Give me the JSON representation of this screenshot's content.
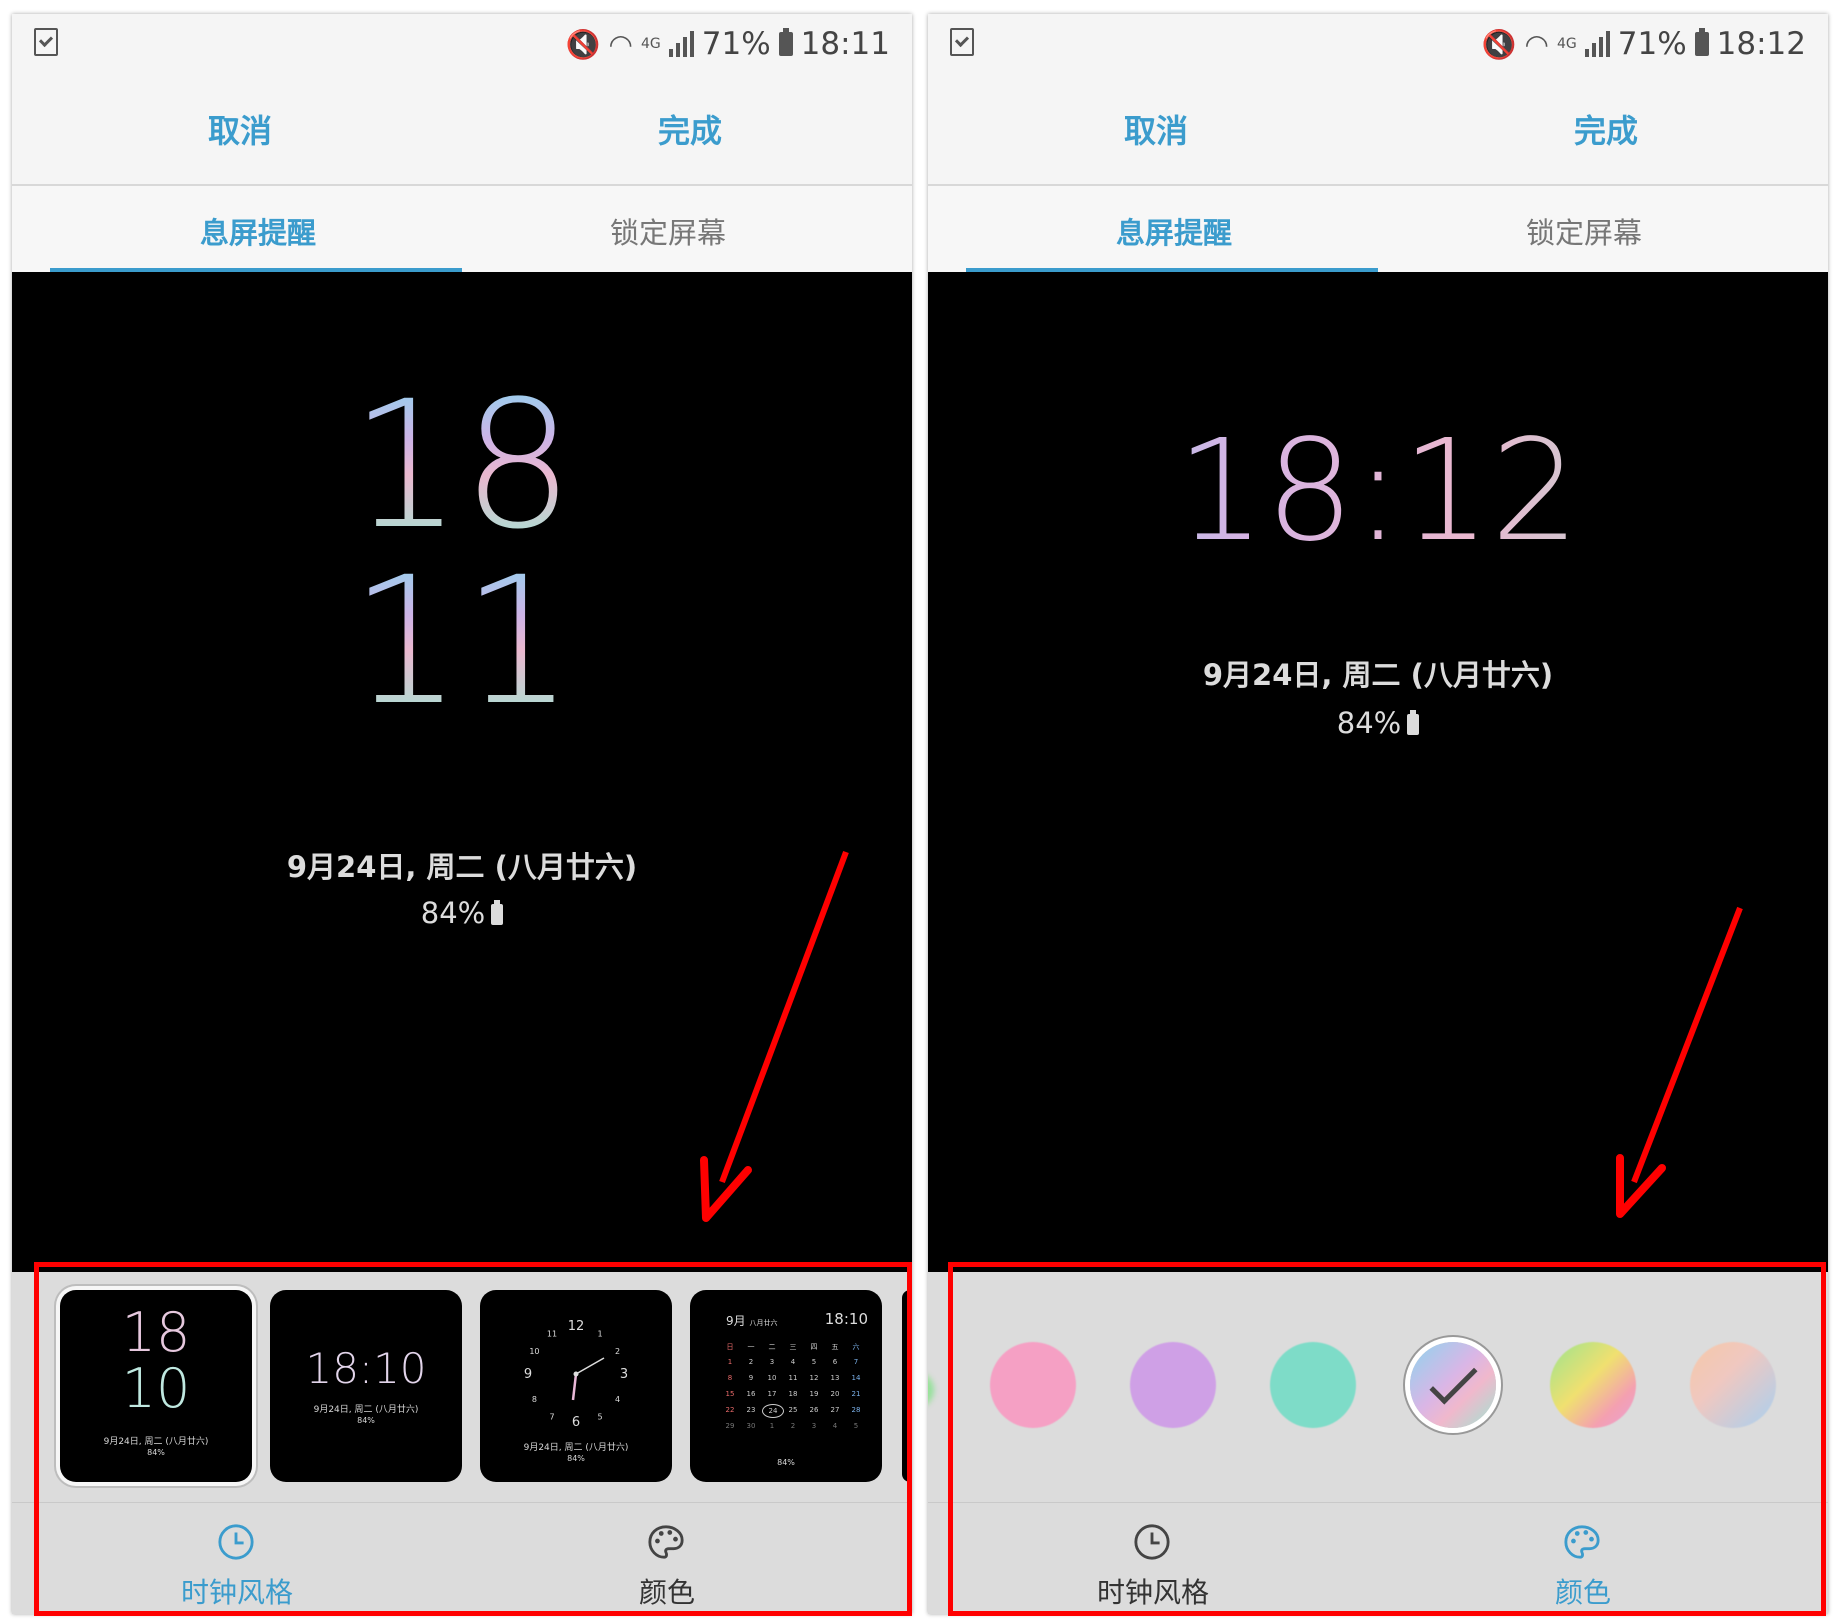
{
  "phones": [
    {
      "status": {
        "signal_tag": "4G",
        "battery": "71%",
        "time": "18:11"
      },
      "action": {
        "cancel": "取消",
        "done": "完成"
      },
      "tabs": {
        "aod": "息屏提醒",
        "lock": "锁定屏幕"
      },
      "clock": {
        "hour": "18",
        "minute": "11"
      },
      "date": "9月24日, 周二 (八月廿六)",
      "battery": "84%",
      "bottom_tabs": {
        "clock_style": "时钟风格",
        "color": "颜色"
      },
      "active_bottom_tab": "clock_style",
      "thumbnails": [
        {
          "hour": "18",
          "minute": "10",
          "date": "9月24日, 周二 (八月廿六)",
          "battery": "84%"
        },
        {
          "time": "18:10",
          "date": "9月24日, 周二 (八月廿六)",
          "battery": "84%"
        },
        {
          "numerals": [
            "12",
            "1",
            "2",
            "3",
            "4",
            "5",
            "6",
            "7",
            "8",
            "9",
            "10",
            "11"
          ],
          "date": "9月24日, 周二 (八月廿六)",
          "battery": "84%"
        },
        {
          "month": "9月",
          "lunar": "八月廿六",
          "time": "18:10",
          "weekdays": [
            "日",
            "一",
            "二",
            "三",
            "四",
            "五",
            "六"
          ],
          "battery": "84%",
          "days": [
            "1",
            "2",
            "3",
            "4",
            "5",
            "6",
            "7",
            "8",
            "9",
            "10",
            "11",
            "12",
            "13",
            "14",
            "15",
            "16",
            "17",
            "18",
            "19",
            "20",
            "21",
            "22",
            "23",
            "24",
            "25",
            "26",
            "27",
            "28",
            "29",
            "30",
            "1",
            "2",
            "3",
            "4",
            "5"
          ]
        }
      ]
    },
    {
      "status": {
        "signal_tag": "4G",
        "battery": "71%",
        "time": "18:12"
      },
      "action": {
        "cancel": "取消",
        "done": "完成"
      },
      "tabs": {
        "aod": "息屏提醒",
        "lock": "锁定屏幕"
      },
      "clock": {
        "time": "18:12"
      },
      "date": "9月24日, 周二 (八月廿六)",
      "battery": "84%",
      "bottom_tabs": {
        "clock_style": "时钟风格",
        "color": "颜色"
      },
      "active_bottom_tab": "color",
      "swatches": [
        "pink",
        "purple",
        "teal",
        "pastel-gradient-selected",
        "rainbow",
        "peach-blue"
      ]
    }
  ],
  "colors": {
    "accent": "#3b9ccd",
    "annotation": "#ff0000"
  }
}
